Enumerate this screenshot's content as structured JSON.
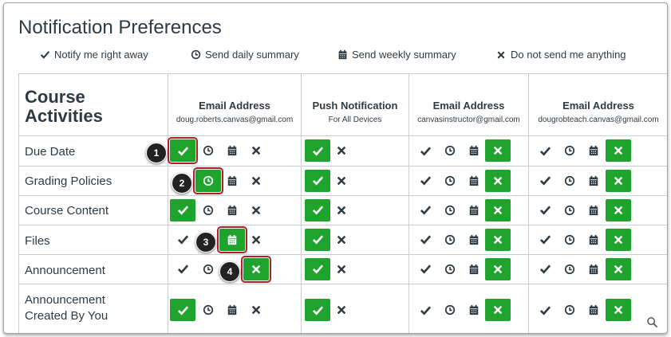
{
  "page_title": "Notification Preferences",
  "legend": [
    {
      "icon": "check-icon",
      "label": "Notify me right away"
    },
    {
      "icon": "clock-icon",
      "label": "Send daily summary"
    },
    {
      "icon": "calendar-icon",
      "label": "Send weekly summary"
    },
    {
      "icon": "x-icon",
      "label": "Do not send me anything"
    }
  ],
  "table": {
    "first_column_title_line1": "Course",
    "first_column_title_line2": "Activities",
    "columns": [
      {
        "title": "Email Address",
        "subtitle": "doug.roberts.canvas@gmail.com"
      },
      {
        "title": "Push Notification",
        "subtitle": "For All Devices"
      },
      {
        "title": "Email Address",
        "subtitle": "canvasinstructor@gmail.com"
      },
      {
        "title": "Email Address",
        "subtitle": "dougrobteach.canvas@gmail.com"
      }
    ],
    "rows": [
      {
        "label": "Due Date",
        "selected": [
          "immediately",
          "immediately",
          "never",
          "never"
        ]
      },
      {
        "label": "Grading Policies",
        "selected": [
          "daily",
          "immediately",
          "never",
          "never"
        ]
      },
      {
        "label": "Course Content",
        "selected": [
          "immediately",
          "immediately",
          "never",
          "never"
        ]
      },
      {
        "label": "Files",
        "selected": [
          "weekly",
          "immediately",
          "never",
          "never"
        ]
      },
      {
        "label": "Announcement",
        "selected": [
          "never",
          "immediately",
          "never",
          "never"
        ]
      },
      {
        "label": "Announcement Created By You",
        "selected": [
          "immediately",
          "immediately",
          "never",
          "never"
        ]
      }
    ]
  },
  "callouts": [
    "1",
    "2",
    "3",
    "4"
  ],
  "colors": {
    "selected_green": "#1ea32c",
    "highlight_red": "#b21f25",
    "text": "#2d3b45"
  },
  "zoom_icon": "magnifier-icon"
}
